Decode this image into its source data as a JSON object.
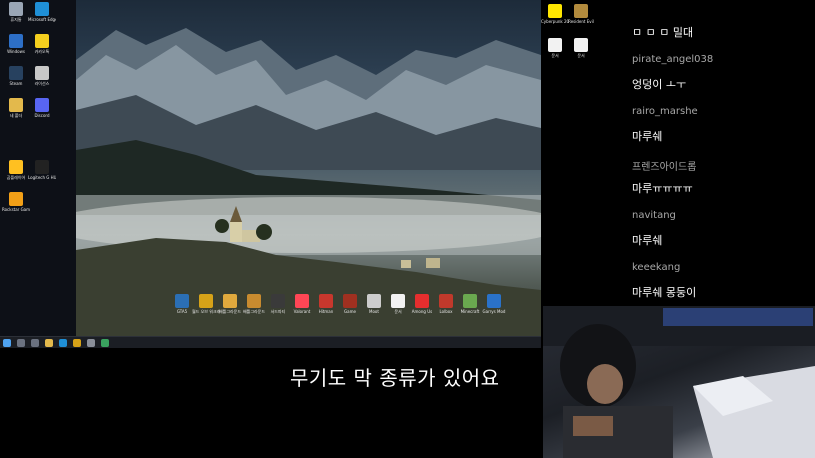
{
  "desktop": {
    "icons_left": [
      {
        "label": "휴지통",
        "color": "#9aa6b5"
      },
      {
        "label": "Microsoft Edge",
        "color": "#1f8fd6"
      },
      {
        "label": "Windows",
        "color": "#2d6fc7"
      },
      {
        "label": "카카오톡",
        "color": "#f5cf1e"
      },
      {
        "label": "Steam",
        "color": "#27415f"
      },
      {
        "label": "라이선스",
        "color": "#c8c8c8"
      },
      {
        "label": "네 폴더",
        "color": "#e3b94c"
      },
      {
        "label": "Discord",
        "color": "#5865f2"
      },
      {
        "label": "곰플레이어",
        "color": "#ffc021"
      },
      {
        "label": "Logitech G HUB",
        "color": "#222222"
      },
      {
        "label": "Rockstar Games",
        "color": "#f3a017"
      }
    ],
    "icons_bottom": [
      {
        "label": "GTA5",
        "color": "#2b6fb5"
      },
      {
        "label": "월드 오브 워크래프트",
        "color": "#d6a218"
      },
      {
        "label": "배틀그라운드",
        "color": "#e0a93d"
      },
      {
        "label": "배틀그라운드",
        "color": "#c88b2f"
      },
      {
        "label": "서드파티",
        "color": "#3a3a3a"
      },
      {
        "label": "Valorant",
        "color": "#ff4655"
      },
      {
        "label": "Hitman",
        "color": "#c8372d"
      },
      {
        "label": "Game",
        "color": "#a03020"
      },
      {
        "label": "Moot",
        "color": "#cccccc"
      },
      {
        "label": "문서",
        "color": "#f2f2f2"
      },
      {
        "label": "Among Us",
        "color": "#e52e2e"
      },
      {
        "label": "Lolbox",
        "color": "#c0392b"
      },
      {
        "label": "Minecraft",
        "color": "#6aa84f"
      },
      {
        "label": "Garrys Mod",
        "color": "#2a72c9"
      }
    ],
    "icons_right": [
      {
        "label": "Cyberpunk 2077",
        "color": "#ffe600"
      },
      {
        "label": "Resident Evil",
        "color": "#b38b3d"
      },
      {
        "label": "문서",
        "color": "#f2f2f2"
      },
      {
        "label": "문서",
        "color": "#f2f2f2"
      }
    ]
  },
  "subtitle": {
    "text": "무기도 막 종류가 있어요"
  },
  "chat": {
    "messages": [
      {
        "user": "",
        "text": "ㅁ ㅁ ㅁ 밀대"
      },
      {
        "user": "pirate_angel038",
        "text": "엉덩이 ㅗㅜ"
      },
      {
        "user": "rairo_marshe",
        "text": "마루쉐"
      },
      {
        "user": "프렌즈아이드롭",
        "text": "마루ㅠㅠㅠㅠ"
      },
      {
        "user": "navitang",
        "text": "마루쉐"
      },
      {
        "user": "keeekang",
        "text": "마루쉐 몽둥이"
      }
    ]
  },
  "colors": {
    "subtitle": "#ffffff",
    "chat_user": "#a8a8a8",
    "chat_text": "#ffffff",
    "taskbar": "#1b1e24"
  }
}
